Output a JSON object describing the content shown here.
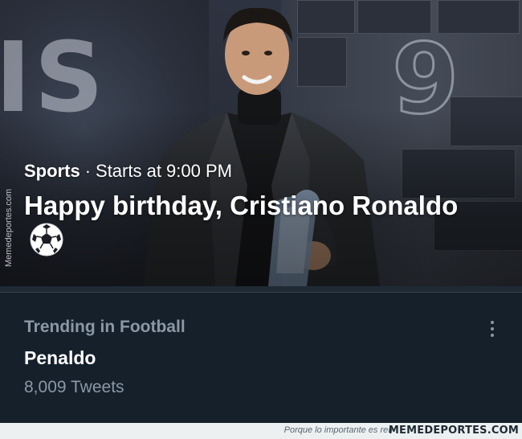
{
  "event": {
    "category": "Sports",
    "separator": "·",
    "time": "Starts at 9:00 PM",
    "title": "Happy birthday, Cristiano Ronaldo",
    "title_icon": "soccer-ball-icon"
  },
  "side_watermark": "Memedeportes.com",
  "trend": {
    "context": "Trending in Football",
    "name": "Penaldo",
    "tweet_count": "8,009 Tweets",
    "more_icon": "more-vertical-icon"
  },
  "footer": {
    "tagline": "Porque lo importante es reír",
    "brand": "MEMEDEPORTES.COM"
  },
  "colors": {
    "background": "#15202b",
    "secondary_text": "#8b98a5",
    "primary_text": "#ffffff"
  }
}
